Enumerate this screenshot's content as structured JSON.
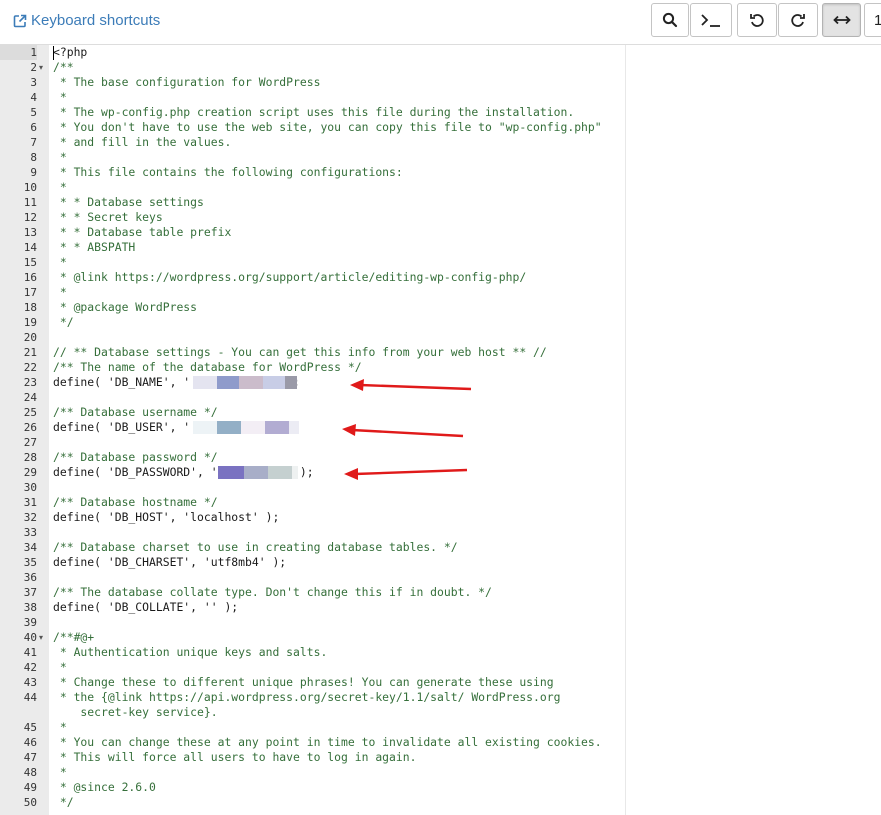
{
  "toolbar": {
    "shortcuts_label": "Keyboard shortcuts",
    "search_icon": "search-icon",
    "terminal_icon": "terminal-icon",
    "undo_icon": "undo-icon",
    "redo_icon": "redo-icon",
    "wrap_icon": "horizontal-arrows-icon",
    "overflow_text": "1"
  },
  "editor": {
    "comment_color": "#356f3a",
    "gutter_color": "#ebebeb",
    "arrow_color": "#e01a1a",
    "lines": [
      {
        "n": "1",
        "text": "<?php",
        "type": "code",
        "active": true
      },
      {
        "n": "2",
        "text": "/**",
        "type": "comment",
        "fold": true
      },
      {
        "n": "3",
        "text": " * The base configuration for WordPress",
        "type": "comment"
      },
      {
        "n": "4",
        "text": " *",
        "type": "comment"
      },
      {
        "n": "5",
        "text": " * The wp-config.php creation script uses this file during the installation.",
        "type": "comment"
      },
      {
        "n": "6",
        "text": " * You don't have to use the web site, you can copy this file to \"wp-config.php\"",
        "type": "comment"
      },
      {
        "n": "7",
        "text": " * and fill in the values.",
        "type": "comment"
      },
      {
        "n": "8",
        "text": " *",
        "type": "comment"
      },
      {
        "n": "9",
        "text": " * This file contains the following configurations:",
        "type": "comment"
      },
      {
        "n": "10",
        "text": " *",
        "type": "comment"
      },
      {
        "n": "11",
        "text": " * * Database settings",
        "type": "comment"
      },
      {
        "n": "12",
        "text": " * * Secret keys",
        "type": "comment"
      },
      {
        "n": "13",
        "text": " * * Database table prefix",
        "type": "comment"
      },
      {
        "n": "14",
        "text": " * * ABSPATH",
        "type": "comment"
      },
      {
        "n": "15",
        "text": " *",
        "type": "comment"
      },
      {
        "n": "16",
        "text": " * @link https://wordpress.org/support/article/editing-wp-config-php/",
        "type": "comment"
      },
      {
        "n": "17",
        "text": " *",
        "type": "comment"
      },
      {
        "n": "18",
        "text": " * @package WordPress",
        "type": "comment"
      },
      {
        "n": "19",
        "text": " */",
        "type": "comment"
      },
      {
        "n": "20",
        "text": "",
        "type": "code"
      },
      {
        "n": "21",
        "text": "// ** Database settings - You can get this info from your web host ** //",
        "type": "comment"
      },
      {
        "n": "22",
        "text": "/** The name of the database for WordPress */",
        "type": "comment"
      },
      {
        "n": "23",
        "text": "define( 'DB_NAME', '            ' );",
        "type": "code",
        "redacted": "name"
      },
      {
        "n": "24",
        "text": "",
        "type": "code"
      },
      {
        "n": "25",
        "text": "/** Database username */",
        "type": "comment"
      },
      {
        "n": "26",
        "text": "define( 'DB_USER', '            ' );",
        "type": "code",
        "redacted": "user"
      },
      {
        "n": "27",
        "text": "",
        "type": "code"
      },
      {
        "n": "28",
        "text": "/** Database password */",
        "type": "comment"
      },
      {
        "n": "29",
        "text": "define( 'DB_PASSWORD', '          ' );",
        "type": "code",
        "redacted": "password"
      },
      {
        "n": "30",
        "text": "",
        "type": "code"
      },
      {
        "n": "31",
        "text": "/** Database hostname */",
        "type": "comment"
      },
      {
        "n": "32",
        "text": "define( 'DB_HOST', 'localhost' );",
        "type": "code"
      },
      {
        "n": "33",
        "text": "",
        "type": "code"
      },
      {
        "n": "34",
        "text": "/** Database charset to use in creating database tables. */",
        "type": "comment"
      },
      {
        "n": "35",
        "text": "define( 'DB_CHARSET', 'utf8mb4' );",
        "type": "code"
      },
      {
        "n": "36",
        "text": "",
        "type": "code"
      },
      {
        "n": "37",
        "text": "/** The database collate type. Don't change this if in doubt. */",
        "type": "comment"
      },
      {
        "n": "38",
        "text": "define( 'DB_COLLATE', '' );",
        "type": "code"
      },
      {
        "n": "39",
        "text": "",
        "type": "code"
      },
      {
        "n": "40",
        "text": "/**#@+",
        "type": "comment",
        "fold": true
      },
      {
        "n": "41",
        "text": " * Authentication unique keys and salts.",
        "type": "comment"
      },
      {
        "n": "42",
        "text": " *",
        "type": "comment"
      },
      {
        "n": "43",
        "text": " * Change these to different unique phrases! You can generate these using",
        "type": "comment"
      },
      {
        "n": "44",
        "text": " * the {@link https://api.wordpress.org/secret-key/1.1/salt/ WordPress.org\n    secret-key service}.",
        "type": "comment",
        "wrap": true
      },
      {
        "n": "45",
        "text": " *",
        "type": "comment"
      },
      {
        "n": "46",
        "text": " * You can change these at any point in time to invalidate all existing cookies.",
        "type": "comment"
      },
      {
        "n": "47",
        "text": " * This will force all users to have to log in again.",
        "type": "comment"
      },
      {
        "n": "48",
        "text": " *",
        "type": "comment"
      },
      {
        "n": "49",
        "text": " * @since 2.6.0",
        "type": "comment"
      },
      {
        "n": "50",
        "text": " */",
        "type": "comment"
      }
    ]
  }
}
